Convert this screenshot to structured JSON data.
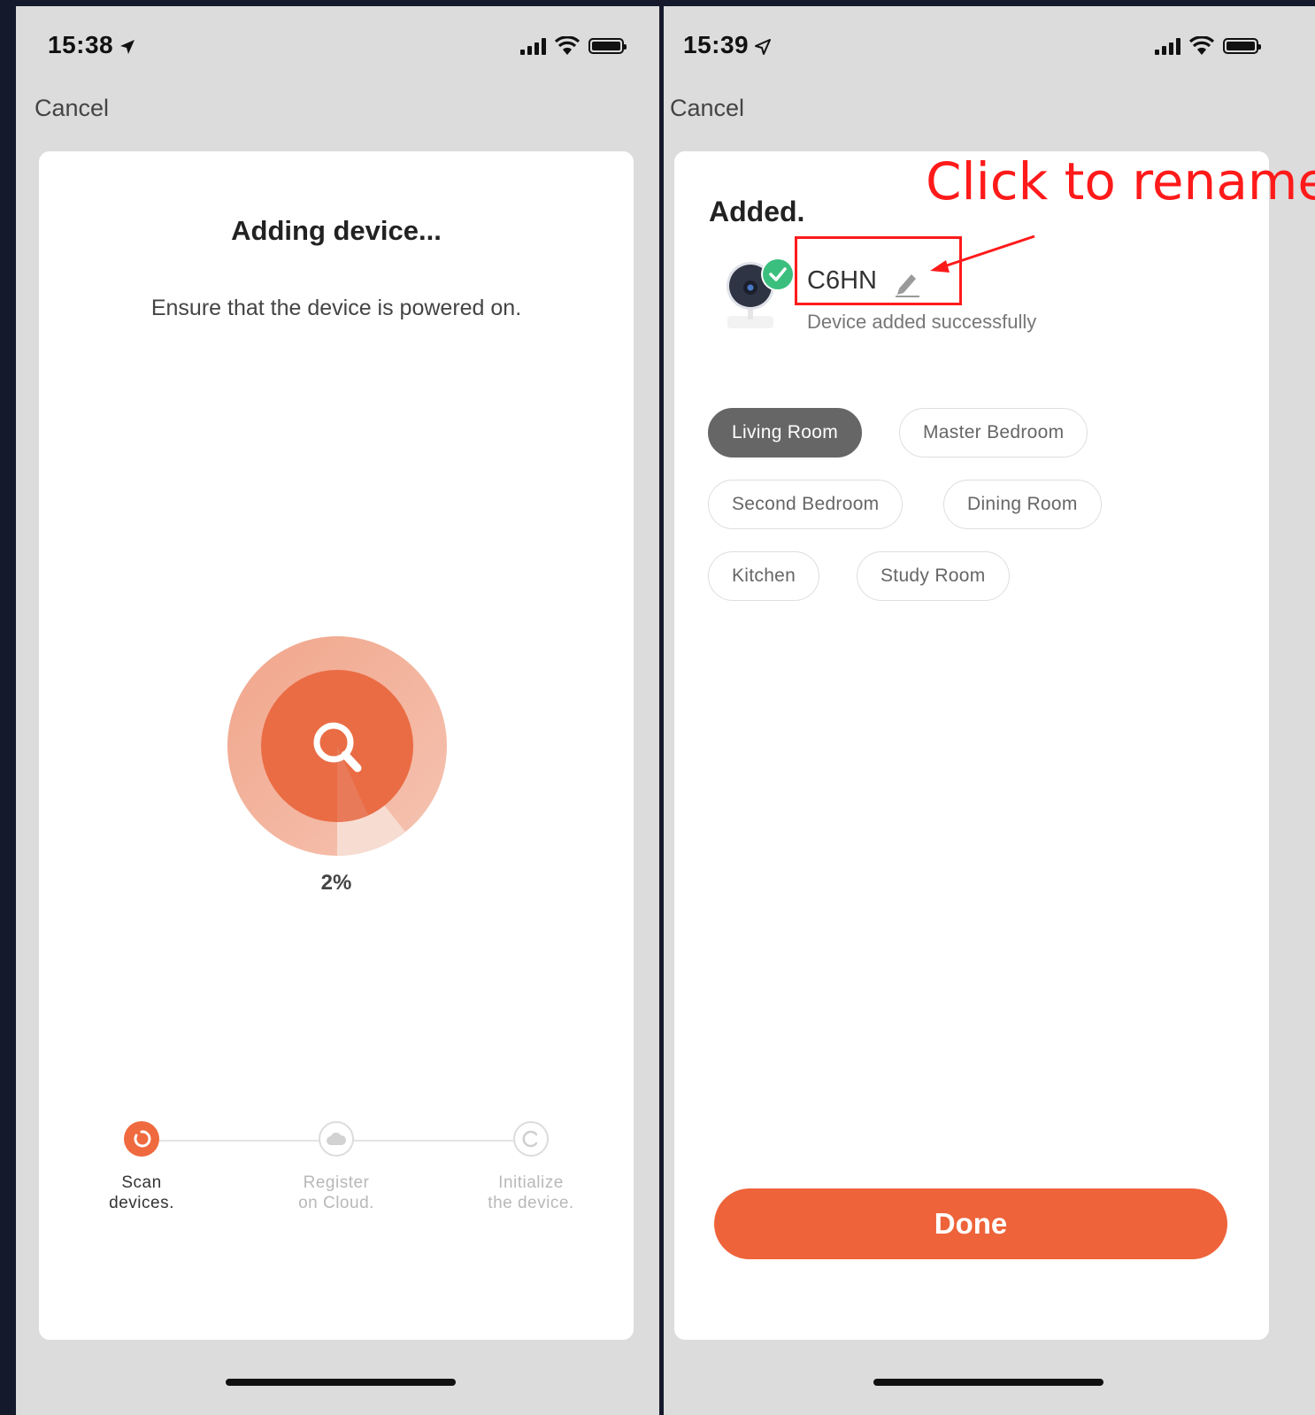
{
  "left_screen": {
    "status_time": "15:38",
    "cancel_label": "Cancel",
    "title": "Adding device...",
    "subtitle": "Ensure that the device is powered on.",
    "progress_text": "2%",
    "progress_value": 0.02,
    "steps": [
      {
        "label_line1": "Scan",
        "label_line2": "devices.",
        "state": "active"
      },
      {
        "label_line1": "Register",
        "label_line2": "on Cloud.",
        "state": "pending"
      },
      {
        "label_line1": "Initialize",
        "label_line2": "the device.",
        "state": "pending"
      }
    ]
  },
  "right_screen": {
    "status_time": "15:39",
    "cancel_label": "Cancel",
    "title": "Added.",
    "device_name": "C6HN",
    "device_status": "Device added successfully",
    "rename_annotation": "Click to rename",
    "rooms": [
      {
        "label": "Living Room",
        "selected": true
      },
      {
        "label": "Master Bedroom",
        "selected": false
      },
      {
        "label": "Second Bedroom",
        "selected": false
      },
      {
        "label": "Dining Room",
        "selected": false
      },
      {
        "label": "Kitchen",
        "selected": false
      },
      {
        "label": "Study Room",
        "selected": false
      }
    ],
    "done_label": "Done"
  },
  "colors": {
    "accent": "#ee633a",
    "success": "#3bbf7e",
    "annotation": "#ff1a1a",
    "selected_chip": "#666666"
  },
  "icons": [
    "location-arrow-icon",
    "signal-icon",
    "wifi-icon",
    "battery-icon",
    "search-icon",
    "cloud-icon",
    "refresh-icon",
    "camera-icon",
    "checkmark-icon",
    "pencil-icon"
  ]
}
